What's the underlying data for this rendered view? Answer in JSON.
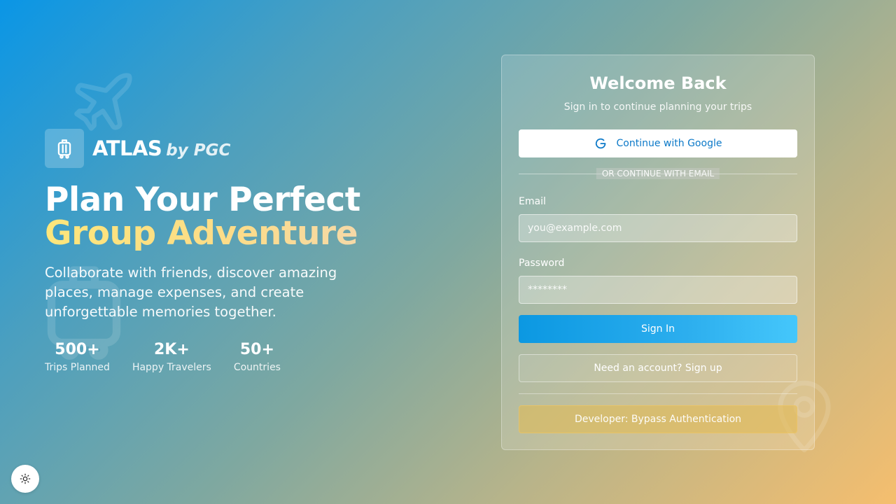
{
  "brand": {
    "name": "ATLAS",
    "by": "by PGC"
  },
  "hero": {
    "line1": "Plan Your Perfect",
    "line2": "Group Adventure",
    "subtitle": "Collaborate with friends, discover amazing places, manage expenses, and create unforgettable memories together."
  },
  "stats": [
    {
      "value": "500+",
      "label": "Trips Planned"
    },
    {
      "value": "2K+",
      "label": "Happy Travelers"
    },
    {
      "value": "50+",
      "label": "Countries"
    }
  ],
  "login": {
    "title": "Welcome Back",
    "subtitle": "Sign in to continue planning your trips",
    "google_label": "Continue with Google",
    "divider": "OR CONTINUE WITH EMAIL",
    "email_label": "Email",
    "email_placeholder": "you@example.com",
    "email_value": "",
    "password_label": "Password",
    "password_placeholder": "********",
    "signin_label": "Sign In",
    "signup_label": "Need an account? Sign up",
    "dev_label": "Developer: Bypass Authentication"
  },
  "icons": {
    "logo": "luggage-icon",
    "google": "google-icon",
    "theme": "sun-icon",
    "decor": [
      "airplane-icon",
      "luggage-icon",
      "map-pin-icon"
    ]
  },
  "colors": {
    "accent": "#0b98e2",
    "google_text": "#0c79c8",
    "hero_highlight": "#fde67b"
  }
}
